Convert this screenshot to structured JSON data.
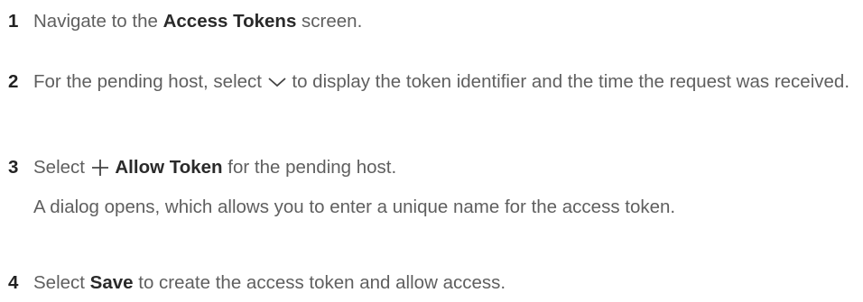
{
  "steps": [
    {
      "number": "1",
      "pre": "Navigate to the ",
      "strong": "Access Tokens",
      "post": " screen."
    },
    {
      "number": "2",
      "pre": "For the pending host, select ",
      "icon": "chevron-down-icon",
      "post": " to display the token identifier and the time the request was received."
    },
    {
      "number": "3",
      "pre": "Select ",
      "icon": "plus-icon",
      "strong": "Allow Token",
      "post": " for the pending host.",
      "note": "A dialog opens, which allows you to enter a unique name for the access token."
    },
    {
      "number": "4",
      "pre": "Select ",
      "strong": "Save",
      "post": " to create the access token and allow access."
    }
  ]
}
